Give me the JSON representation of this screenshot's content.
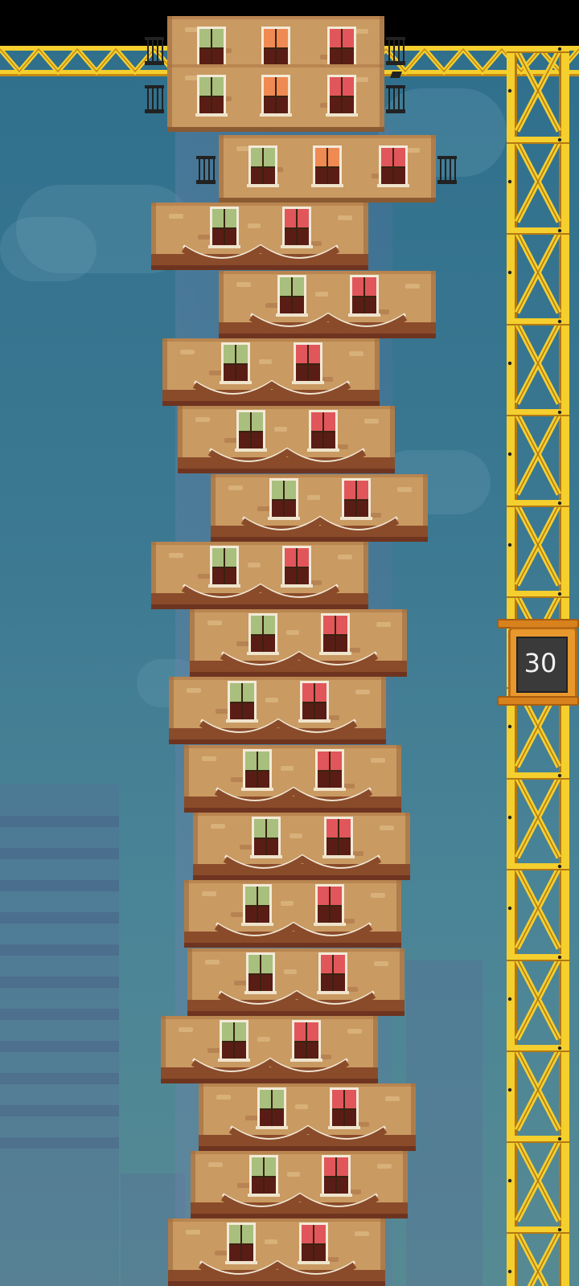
{
  "game": {
    "floor_count": "30",
    "floors_visible": 19
  },
  "colors": {
    "sky": "#3b7891",
    "brick": "#c99a62",
    "brick_dark": "#8a4b2a",
    "window_green": "#a8bf7e",
    "window_red": "#e0565a",
    "window_orange": "#ee8a52",
    "crane_yellow": "#f5cf2e",
    "elevator_orange": "#e8982c"
  },
  "icons": {
    "balcony": "balcony-railing-icon",
    "window": "window-icon"
  }
}
